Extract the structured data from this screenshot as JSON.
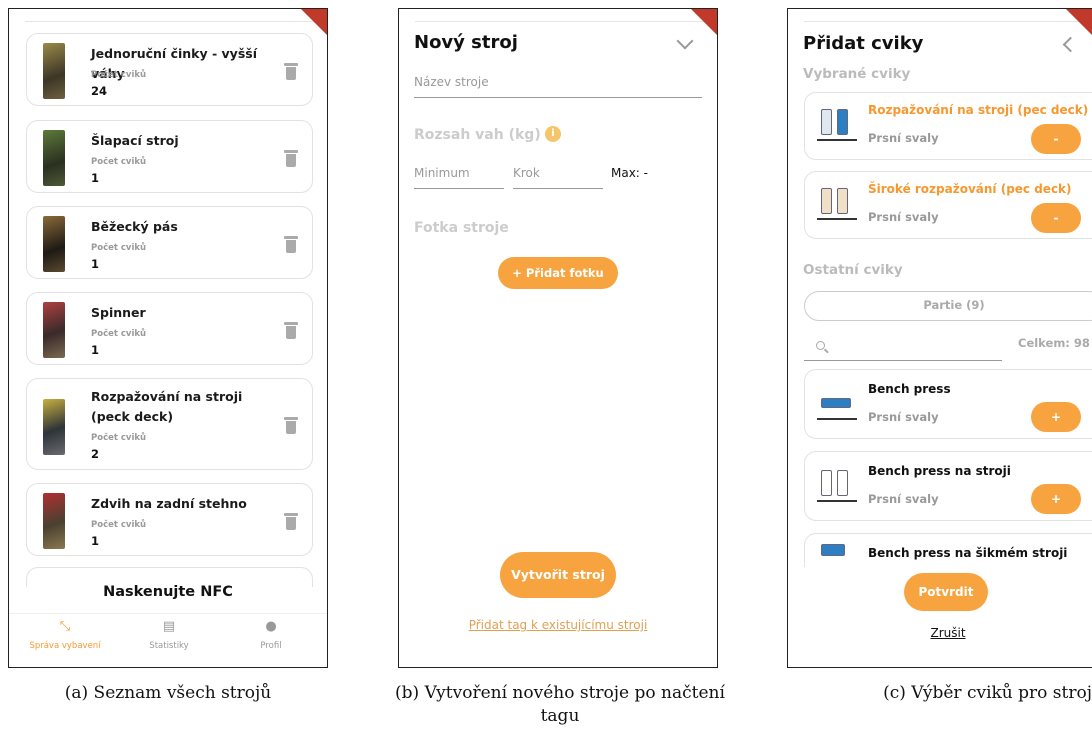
{
  "panel_a": {
    "machines": [
      {
        "name": "Jednoruční činky - vyšší váhy",
        "count_label": "Počet cviků",
        "count": "24"
      },
      {
        "name": "Šlapací stroj",
        "count_label": "Počet cviků",
        "count": "1"
      },
      {
        "name": "Běžecký pás",
        "count_label": "Počet cviků",
        "count": "1"
      },
      {
        "name": "Spinner",
        "count_label": "Počet cviků",
        "count": "1"
      },
      {
        "name": "Rozpažování na stroji (peck deck)",
        "count_label": "Počet cviků",
        "count": "2"
      },
      {
        "name": "Zdvih na zadní stehno",
        "count_label": "Počet cviků",
        "count": "1"
      }
    ],
    "nfc_prompt": "Naskenujte NFC",
    "nav": [
      {
        "label": "Správa vybavení",
        "icon": "equipment-icon",
        "active": true
      },
      {
        "label": "Statistiky",
        "icon": "stats-icon",
        "active": false
      },
      {
        "label": "Profil",
        "icon": "profile-icon",
        "active": false
      }
    ],
    "caption": "(a) Seznam všech strojů"
  },
  "panel_b": {
    "title": "Nový stroj",
    "name_placeholder": "Název stroje",
    "weight_range_label": "Rozsah vah (kg)",
    "min_placeholder": "Minimum",
    "step_placeholder": "Krok",
    "max_text": "Max: -",
    "photo_label": "Fotka stroje",
    "add_photo": "+ Přidat fotku",
    "create": "Vytvořit stroj",
    "add_tag_link": "Přidat tag k existujícímu stroji",
    "caption": "(b) Vytvoření nového stroje po načtení tagu"
  },
  "panel_c": {
    "title": "Přidat cviky",
    "selected_label": "Vybrané cviky",
    "selected": [
      {
        "name": "Rozpažování na stroji (pec deck)",
        "muscle": "Prsní svaly",
        "action": "-"
      },
      {
        "name": "Široké rozpažování (pec deck)",
        "muscle": "Prsní svaly",
        "action": "-"
      }
    ],
    "others_label": "Ostatní cviky",
    "partie": "Partie (9)",
    "total": "Celkem: 98",
    "others": [
      {
        "name": "Bench press",
        "muscle": "Prsní svaly",
        "action": "+"
      },
      {
        "name": "Bench press na stroji",
        "muscle": "Prsní svaly",
        "action": "+"
      },
      {
        "name": "Bench press na šikmém stroji",
        "muscle": "",
        "action": ""
      }
    ],
    "confirm": "Potvrdit",
    "cancel": "Zrušit",
    "caption": "(c) Výběr cviků pro stroj"
  },
  "colors": {
    "accent": "#f7a440",
    "ribbon": "#c0392b"
  }
}
